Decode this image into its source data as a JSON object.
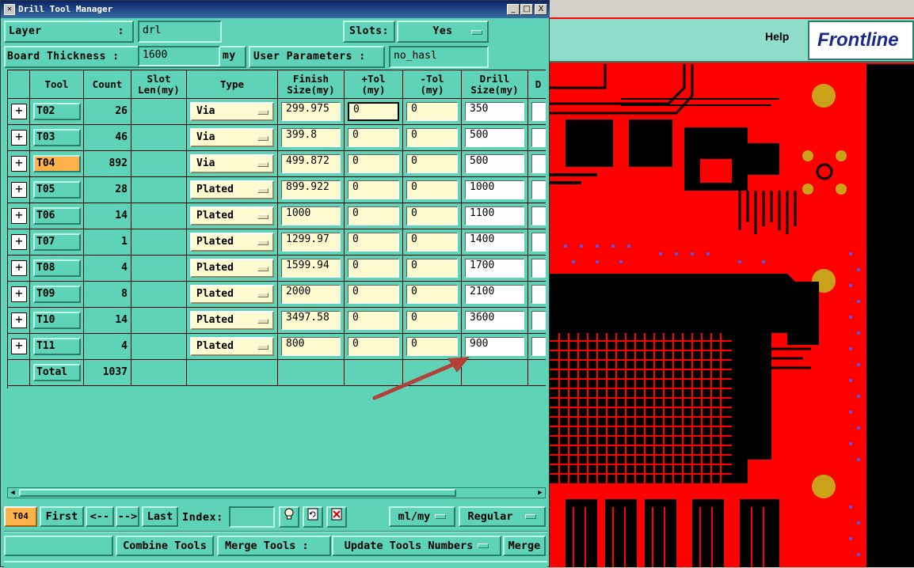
{
  "window": {
    "title": "Drill Tool Manager",
    "minimize": "_",
    "maximize": "□",
    "close": "X"
  },
  "header": {
    "layer_label": "Layer",
    "layer_colon": ":",
    "layer_value": "drl",
    "slots_label": "Slots:",
    "slots_value": "Yes",
    "thickness_label": "Board Thickness :",
    "thickness_value": "1600",
    "thickness_unit": "my",
    "user_params_label": "User Parameters :",
    "user_params_value": "no_hasl"
  },
  "table": {
    "columns": [
      "Tool",
      "Count",
      "Slot\nLen(my)",
      "Type",
      "Finish\nSize(my)",
      "+Tol\n(my)",
      "-Tol\n(my)",
      "Drill\nSize(my)",
      "D"
    ],
    "rows": [
      {
        "tool": "T02",
        "count": "26",
        "type": "Via",
        "finish": "299.975",
        "ptol": "0",
        "ntol": "0",
        "drill": "350"
      },
      {
        "tool": "T03",
        "count": "46",
        "type": "Via",
        "finish": "399.8",
        "ptol": "0",
        "ntol": "0",
        "drill": "500"
      },
      {
        "tool": "T04",
        "count": "892",
        "type": "Via",
        "finish": "499.872",
        "ptol": "0",
        "ntol": "0",
        "drill": "500"
      },
      {
        "tool": "T05",
        "count": "28",
        "type": "Plated",
        "finish": "899.922",
        "ptol": "0",
        "ntol": "0",
        "drill": "1000"
      },
      {
        "tool": "T06",
        "count": "14",
        "type": "Plated",
        "finish": "1000",
        "ptol": "0",
        "ntol": "0",
        "drill": "1100"
      },
      {
        "tool": "T07",
        "count": "1",
        "type": "Plated",
        "finish": "1299.97",
        "ptol": "0",
        "ntol": "0",
        "drill": "1400"
      },
      {
        "tool": "T08",
        "count": "4",
        "type": "Plated",
        "finish": "1599.94",
        "ptol": "0",
        "ntol": "0",
        "drill": "1700"
      },
      {
        "tool": "T09",
        "count": "8",
        "type": "Plated",
        "finish": "2000",
        "ptol": "0",
        "ntol": "0",
        "drill": "2100"
      },
      {
        "tool": "T10",
        "count": "14",
        "type": "Plated",
        "finish": "3497.58",
        "ptol": "0",
        "ntol": "0",
        "drill": "3600"
      },
      {
        "tool": "T11",
        "count": "4",
        "type": "Plated",
        "finish": "800",
        "ptol": "0",
        "ntol": "0",
        "drill": "900"
      }
    ],
    "total_label": "Total",
    "total_value": "1037",
    "selected_tool": "T04",
    "expand_glyph": "+"
  },
  "nav": {
    "current": "T04",
    "first": "First",
    "prev": "<--",
    "next": "-->",
    "last": "Last",
    "index_label": "Index:",
    "units": "ml/my",
    "mode": "Regular"
  },
  "actions": {
    "combine": "Combine Tools",
    "merge_label": "Merge Tools :",
    "update": "Update Tools Numbers",
    "merge": "Merge"
  },
  "right_panel": {
    "help": "Help",
    "brand": "Frontline"
  },
  "colors": {
    "panel": "#5fd3b8",
    "input_yellow": "#fffbd0",
    "selected_tool": "#ffb24a",
    "pcb_red": "#ff0000",
    "pcb_trace": "#000000",
    "pad_gold": "#c9a21a",
    "arrow": "#b5403a"
  },
  "icons": [
    "window-menu-icon",
    "minimize-icon",
    "maximize-icon",
    "close-icon",
    "expand-icon",
    "lightbulb-icon",
    "refresh-icon",
    "delete-icon",
    "dropdown-icon",
    "brand-logo-icon"
  ]
}
